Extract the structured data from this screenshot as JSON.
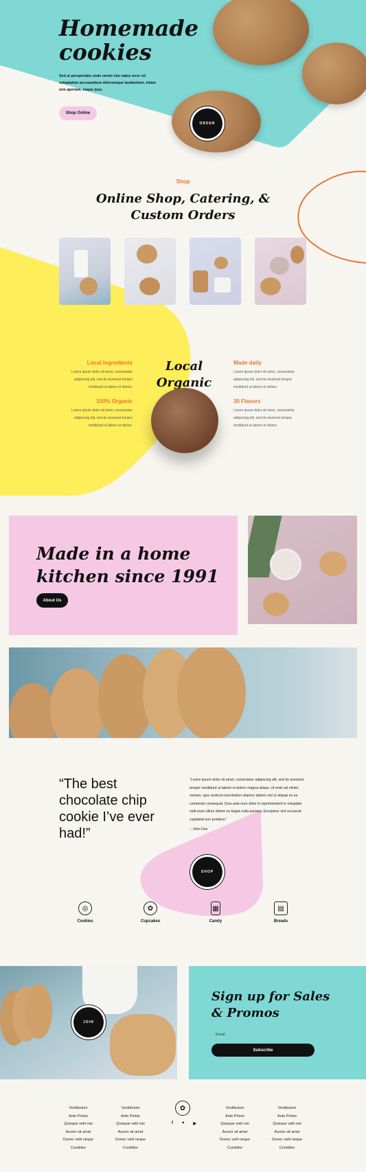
{
  "hero": {
    "title_line1": "Homemade",
    "title_line2": "cookies",
    "text": "Sed ut perspiciatis unde omnis iste natus error sit voluptatem accusantium doloremque laudantium, totam rem aperiam, eaque ipsa.",
    "shop_button": "Shop Online",
    "order_button": "ORDER"
  },
  "shop": {
    "eyebrow": "Shop",
    "heading_line1": "Online Shop, Catering, &",
    "heading_line2": "Custom Orders"
  },
  "local": {
    "heading_line1": "Local",
    "heading_line2": "Organic",
    "features": [
      {
        "title": "Local Ingredients",
        "text": "Lorem ipsum dolor sit amet, consectetur adipiscing elit, sed do eiusmod tempor incididunt ut labore et dolore."
      },
      {
        "title": "100% Organic",
        "text": "Lorem ipsum dolor sit amet, consectetur adipiscing elit, sed do eiusmod tempor incididunt ut labore et dolore."
      },
      {
        "title": "Made daily",
        "text": "Lorem ipsum dolor sit amet, consectetur adipiscing elit, sed do eiusmod tempor incididunt ut labore et dolore."
      },
      {
        "title": "30 Flavors",
        "text": "Lorem ipsum dolor sit amet, consectetur adipiscing elit, sed do eiusmod tempor incididunt ut labore et dolore."
      }
    ]
  },
  "about": {
    "heading_line1": "Made in a home",
    "heading_line2": "kitchen since 1991",
    "button": "About Us"
  },
  "testimonial": {
    "quote": "“The best chocolate chip cookie I’ve ever had!”",
    "text": "“Lorem ipsum dolor sit amet, consectetur adipiscing elit, sed do eiusmod tempor incididunt ut labore et dolore magna aliqua. Ut enim ad minim veniam, quis nostrud exercitation ullamco laboris nisi ut aliquip ex ea commodo consequat. Duis aute irure dolor in reprehenderit in voluptate velit esse cillum dolore eu fugiat nulla pariatur. Excepteur sint occaecat cupidatat non proident.”",
    "author": "– John Doe",
    "shop_button": "SHOP"
  },
  "categories": [
    {
      "label": "Cookies",
      "icon": "cookie-icon"
    },
    {
      "label": "Cupcakes",
      "icon": "cupcake-icon"
    },
    {
      "label": "Candy",
      "icon": "candy-icon"
    },
    {
      "label": "Breads",
      "icon": "bread-icon"
    }
  ],
  "signup": {
    "heading_line1": "Sign up for Sales",
    "heading_line2": "& Promos",
    "email_placeholder": "Email",
    "subscribe": "Subscribe",
    "join_button": "JOIN"
  },
  "footer": {
    "col1": [
      "Vestibulum",
      "Ante Primis",
      "Quisque velit nisi",
      "Auctor sit amet",
      "Donec velit neque",
      "Curabitur"
    ],
    "col2": [
      "Vestibulum",
      "Ante Primis",
      "Quisque velit nisi",
      "Auctor sit amet",
      "Donec velit neque",
      "Curabitur"
    ],
    "col3": [
      "Vestibulum",
      "Ante Primis",
      "Quisque velit nisi",
      "Auctor sit amet",
      "Donec velit neque",
      "Curabitur"
    ],
    "col4": [
      "Vestibulum",
      "Ante Primis",
      "Quisque velit nisi",
      "Auctor sit amet",
      "Donec velit neque",
      "Curabitur"
    ],
    "social": [
      "f",
      "t",
      "yt"
    ]
  },
  "colors": {
    "teal": "#7fd8d4",
    "yellow": "#fdee5a",
    "pink": "#f5c9e4",
    "orange": "#e8742f",
    "background": "#f7f5f0"
  }
}
